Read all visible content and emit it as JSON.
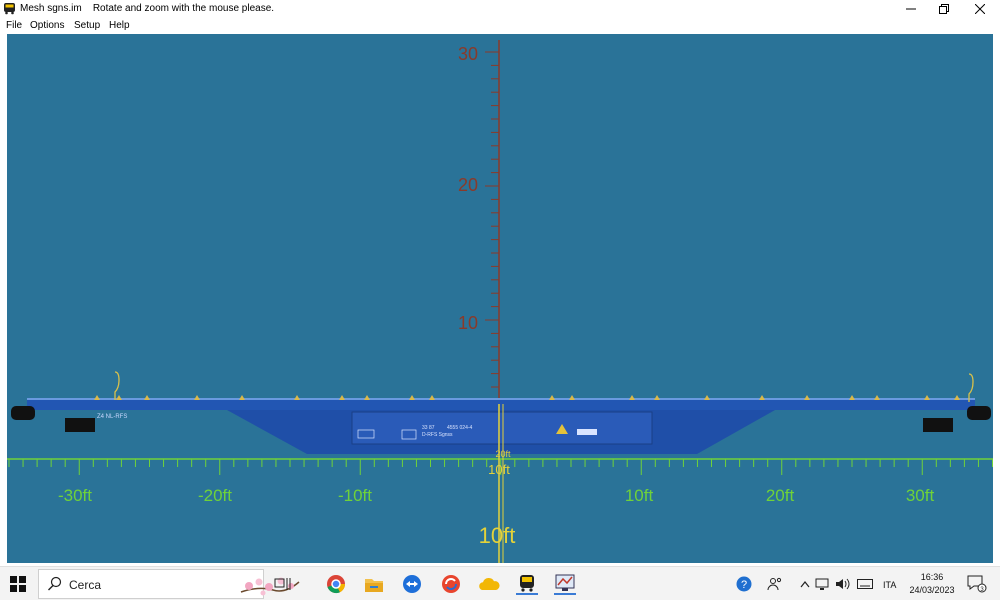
{
  "window": {
    "title": "Mesh sgns.im",
    "subtitle": "Rotate and zoom with the mouse please."
  },
  "menu": [
    "File",
    "Options",
    "Setup",
    "Help"
  ],
  "viewport": {
    "background": "#2a7398",
    "v_axis_labels": [
      "30",
      "20",
      "10"
    ],
    "h_axis_labels": [
      "-30ft",
      "-20ft",
      "-10ft",
      "10ft",
      "20ft",
      "30ft"
    ],
    "depth_labels": [
      "20ft",
      "10ft",
      "10ft"
    ],
    "colors": {
      "vertical_axis": "#8a3a2a",
      "horizontal_axis": "#6fd23a",
      "depth_axis": "#e3d23a",
      "wagon": "#1f4fa8"
    }
  },
  "wagon_markings": {
    "left_text": "Z4 NL-RFS",
    "center_text_1": "33 87",
    "center_text_2": "4555 024-4",
    "center_text_3": "D-RFS Sgnss"
  },
  "taskbar": {
    "search_placeholder": "Cerca",
    "icons": [
      "windows-start-icon",
      "task-view-icon",
      "chrome-icon",
      "file-explorer-icon",
      "teamviewer-icon",
      "cleaner-icon",
      "onedrive-icon",
      "train-app-icon",
      "mesh-viewer-icon"
    ],
    "tray": {
      "help": "?",
      "language": "ITA",
      "time": "16:36",
      "date": "24/03/2023",
      "notifications": "3"
    }
  }
}
